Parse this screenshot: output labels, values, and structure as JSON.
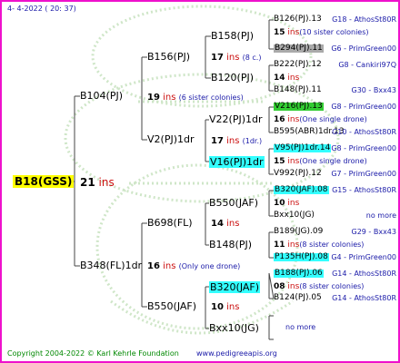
{
  "header": {
    "date": "4-   4-2022  ( 20:  37)"
  },
  "root": {
    "name": "B18(GSS)",
    "ins_num": "21",
    "ins_label": "ins"
  },
  "gen1": [
    {
      "name": "B104(PJ)",
      "ins_num": "19",
      "ins_label": "ins",
      "note": "(6 sister colonies)"
    },
    {
      "name": "B348(FL)1dr",
      "ins_num": "16",
      "ins_label": "ins",
      "note": "(Only one drone)"
    }
  ],
  "gen2": [
    {
      "name": "B156(PJ)",
      "ins_num": "17",
      "ins_label": "ins",
      "note": "(8 c.)"
    },
    {
      "name": "V2(PJ)1dr",
      "ins_num": "17",
      "ins_label": "ins",
      "note": "(1dr.)"
    },
    {
      "name": "B698(FL)",
      "ins_num": "14",
      "ins_label": "ins"
    },
    {
      "name": "B550(JAF)",
      "ins_num": "10",
      "ins_label": "ins"
    }
  ],
  "gen3": [
    {
      "name": "B158(PJ)"
    },
    {
      "name": "B120(PJ)"
    },
    {
      "name": "V22(PJ)1dr"
    },
    {
      "name": "V16(PJ)1dr"
    },
    {
      "name": "B550(JAF)"
    },
    {
      "name": "B148(PJ)"
    },
    {
      "name": "B320(JAF)"
    },
    {
      "name": "Bxx10(JG)"
    }
  ],
  "gen4": [
    {
      "name": "B126(PJ).13",
      "src": "G18 - AthosSt80R",
      "ins_num": "15",
      "ins_label": "ins",
      "note": "(10 sister colonies)"
    },
    {
      "name": "B294(PJ).11",
      "src": "G6 - PrimGreen00"
    },
    {
      "name": "B222(PJ).12",
      "src": "G8 - Cankiri97Q",
      "ins_num": "14",
      "ins_label": "ins"
    },
    {
      "name": "B148(PJ).11",
      "src": "G30 - Bxx43"
    },
    {
      "name": "V216(PJ).13",
      "src": "G8 - PrimGreen00",
      "ins_num": "16",
      "ins_label": "ins",
      "note": "(One single drone)"
    },
    {
      "name": "B595(ABR)1dr.13",
      "src": "G10 - AthosSt80R"
    },
    {
      "name": "V95(PJ)1dr.14",
      "src": "G8 - PrimGreen00",
      "ins_num": "15",
      "ins_label": "ins",
      "note": "(One single drone)"
    },
    {
      "name": "V992(PJ).12",
      "src": "G7 - PrimGreen00"
    },
    {
      "name": "B320(JAF).08",
      "src": "G15 - AthosSt80R",
      "ins_num": "10",
      "ins_label": "ins"
    },
    {
      "name": "Bxx10(JG)",
      "src": "no more"
    },
    {
      "name": "B189(JG).09",
      "src": "G29 - Bxx43",
      "ins_num": "11",
      "ins_label": "ins",
      "note": "(8 sister colonies)"
    },
    {
      "name": "P135H(PJ).08",
      "src": "G4 - PrimGreen00"
    },
    {
      "name": "B188(PJ).06",
      "src": "G14 - AthosSt80R",
      "ins_num": "08",
      "ins_label": "ins",
      "note": "(8 sister colonies)"
    },
    {
      "name": "B124(PJ).05",
      "src": "G14 - AthosSt80R"
    }
  ],
  "no_more": "no more",
  "footer": {
    "copyright": "Copyright 2004-2022 © Karl Kehrle Foundation",
    "site": "www.pedigreeapis.org"
  },
  "colors": {
    "frame": "#ee11cc",
    "root_bg": "#ffff00",
    "cyan": "#33ffff",
    "green": "#33cc33",
    "gray": "#aaaaaa",
    "ins": "#cc1111",
    "source": "#1a1aa8",
    "footer": "#008800"
  }
}
